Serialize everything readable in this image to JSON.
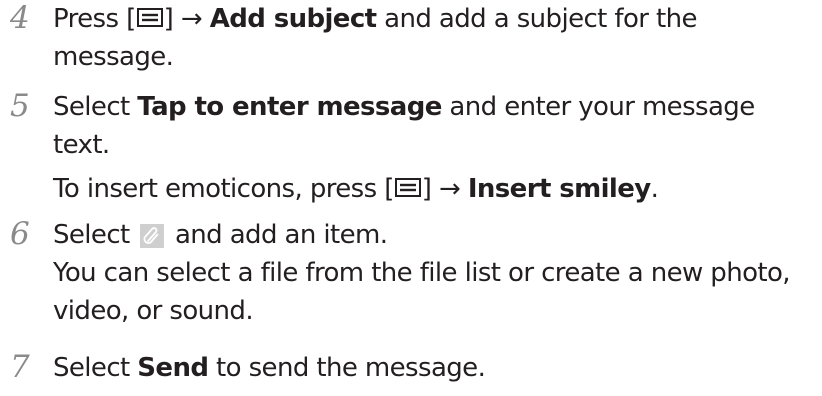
{
  "steps": [
    {
      "number": "4",
      "line1_a": "Press [",
      "key_icon": "menu-key-icon",
      "line1_b": "] → ",
      "line1_bold": "Add subject",
      "line1_c": " and add a subject for the",
      "line2": "message."
    },
    {
      "number": "5",
      "line1_a": "Select ",
      "line1_bold": "Tap to enter message",
      "line1_c": " and enter your message",
      "line2": "text.",
      "line3_a": "To insert emoticons, press [",
      "key_icon": "menu-key-icon",
      "line3_b": "] → ",
      "line3_bold": "Insert smiley",
      "line3_c": "."
    },
    {
      "number": "6",
      "line1_a": "Select ",
      "attach_icon": "paperclip-icon",
      "line1_c": " and add an item.",
      "line2": "You can select a file from the file list or create a new photo,",
      "line3": "video, or sound."
    },
    {
      "number": "7",
      "line1_a": "Select ",
      "line1_bold": "Send",
      "line1_c": " to send the message."
    }
  ]
}
